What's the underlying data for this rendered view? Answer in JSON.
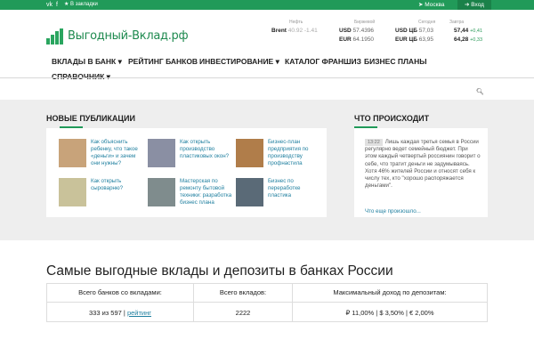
{
  "topbar": {
    "vk_icon": "vk-icon",
    "facebook_icon": "facebook-icon",
    "bookmark_label": "★ В закладки",
    "city": "Москва",
    "login": "Вход"
  },
  "logo": {
    "text": "Выгодный-Вклад.рф"
  },
  "quotes": {
    "oil": {
      "header": "Нефть",
      "label": "Brent",
      "value": "40.92 -1.41"
    },
    "exchange": {
      "header": "Биржевой",
      "rows": [
        {
          "label": "USD",
          "value": "57.4396"
        },
        {
          "label": "EUR",
          "value": "64.1950"
        }
      ]
    },
    "today": {
      "header": "Сегодня",
      "rows": [
        {
          "label": "USD ЦБ",
          "value": "57,03"
        },
        {
          "label": "EUR ЦБ",
          "value": "63,95"
        }
      ]
    },
    "tomorrow": {
      "header": "Завтра",
      "rows": [
        {
          "value": "57,44",
          "change": "+0,41"
        },
        {
          "value": "64,28",
          "change": "+0,33"
        }
      ]
    }
  },
  "menu": {
    "items": [
      {
        "label": "ВКЛАДЫ В БАНК ▾"
      },
      {
        "label": "РЕЙТИНГ БАНКОВ"
      },
      {
        "label": "ИНВЕСТИРОВАНИЕ ▾"
      },
      {
        "label": "КАТАЛОГ ФРАНШИЗ"
      },
      {
        "label": "БИЗНЕС ПЛАНЫ"
      },
      {
        "label": "СПРАВОЧНИК ▾"
      }
    ],
    "search_icon": "search-icon"
  },
  "publications": {
    "title": "НОВЫЕ ПУБЛИКАЦИИ",
    "items": [
      {
        "text": "Как объяснить ребенку, что такое «деньги» и зачем они нужны?",
        "thumb": "#c8a37a"
      },
      {
        "text": "Как открыть производство пластиковых окон?",
        "thumb": "#8a8fa3"
      },
      {
        "text": "Бизнес-план предприятия по производству профнастила",
        "thumb": "#b07d4a"
      },
      {
        "text": "Как открыть сыроварню?",
        "thumb": "#c9c29a"
      },
      {
        "text": "Мастерская по ремонту бытовой техники: разработка бизнес плана",
        "thumb": "#7f8c8d"
      },
      {
        "text": "Бизнес по переработке пластика",
        "thumb": "#5a6a77"
      }
    ]
  },
  "happening": {
    "title": "ЧТО ПРОИСХОДИТ",
    "time": "13:22",
    "text": "Лишь каждая третья семья в России регулярно ведет семейный бюджет. При этом каждый четвертый россиянин говорит о себе, что тратит деньги не задумываясь. Хотя 46% жителей России и относят себя к числу тех, кто \"хорошо распоряжается деньгами\".",
    "more": "Что еще произошло..."
  },
  "main": {
    "title": "Самые выгодные вклады и депозиты в банках России",
    "headers": [
      "Всего банков со вкладами:",
      "Всего вкладов:",
      "Максимальный доход по депозитам:"
    ],
    "banks_count": "333 из 597",
    "banks_link": "рейтинг",
    "deposits_count": "2222",
    "max_income": "₽ 11,00% | $ 3,50% | € 2,00%"
  }
}
